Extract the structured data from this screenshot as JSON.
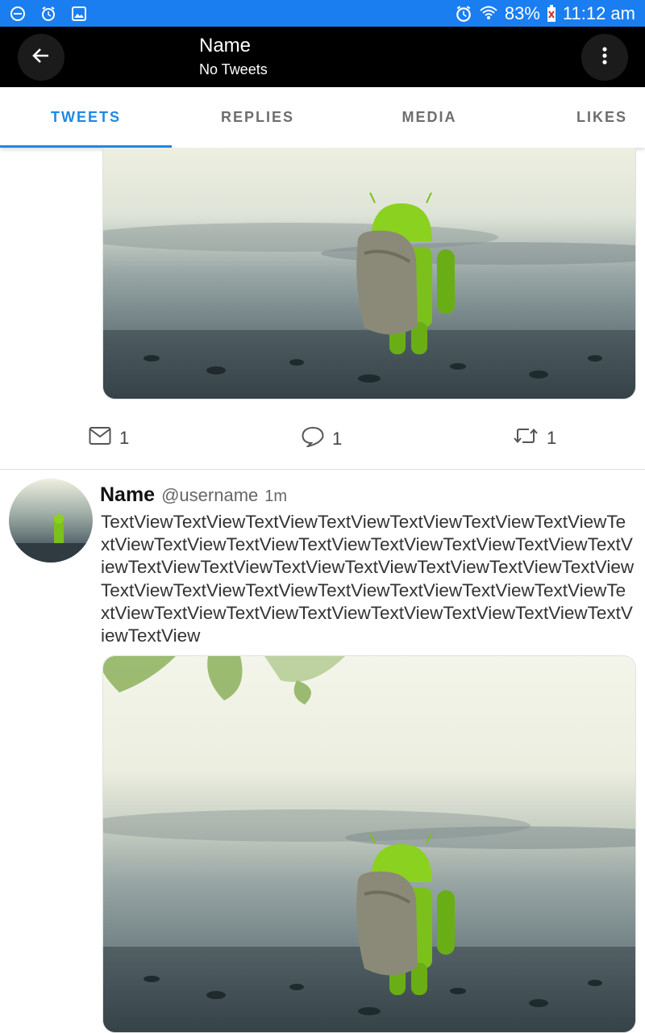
{
  "status_bar": {
    "battery": "83%",
    "time": "11:12 am"
  },
  "header": {
    "title": "Name",
    "subtitle": "No Tweets",
    "back_icon": "arrow-left-icon",
    "menu_icon": "more-vertical-icon"
  },
  "tabs": [
    {
      "label": "TWEETS",
      "active": true
    },
    {
      "label": "REPLIES",
      "active": false
    },
    {
      "label": "MEDIA",
      "active": false
    },
    {
      "label": "LIKES",
      "active": false
    }
  ],
  "colors": {
    "status_bar": "#1a7ef0",
    "app_bar": "#000000",
    "accent": "#1e88e5"
  },
  "feed": {
    "previous_tweet": {
      "actions": {
        "messages": "1",
        "replies": "1",
        "retweets": "1"
      }
    },
    "tweet": {
      "name": "Name",
      "username": "@username",
      "time": "1m",
      "text": "TextViewTextViewTextViewTextViewTextViewTextViewTextViewTextViewTextViewTextViewTextViewTextViewTextViewTextViewTextViewTextViewTextViewTextViewTextViewTextViewTextViewTextViewTextViewTextViewTextViewTextViewTextViewTextViewTextViewTextViewTextViewTextViewTextViewTextViewTextViewTextViewTextViewTextView"
    }
  }
}
